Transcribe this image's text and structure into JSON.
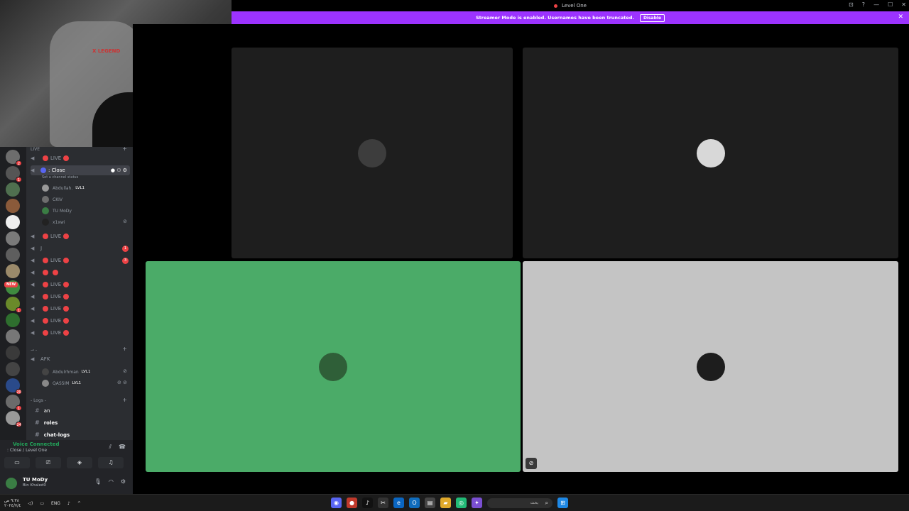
{
  "window": {
    "title": "Level One",
    "controls": {
      "minimize": "—",
      "maximize": "☐",
      "close": "✕"
    }
  },
  "banner": {
    "message": "Streamer Mode is enabled. Usernames have been truncated.",
    "disable_label": "Disable",
    "close_glyph": "✕"
  },
  "webcam": {
    "chair_brand": "X LEGEND"
  },
  "channels": {
    "top_category": "LIVE",
    "list": [
      {
        "label": "LIVE",
        "badges": 2
      },
      {
        "label": ": Close",
        "active": true,
        "status": "Set a channel status"
      },
      {
        "label": "LIVE",
        "badges": 2,
        "count": "1"
      },
      {
        "label": "J",
        "count": ""
      },
      {
        "label": "LIVE",
        "badges": 2,
        "count": "3"
      },
      {
        "label": "",
        "badges": 2
      },
      {
        "label": "LIVE",
        "badges": 2
      },
      {
        "label": "LIVE",
        "badges": 2
      },
      {
        "label": "LIVE",
        "badges": 2
      },
      {
        "label": "LIVE",
        "badges": 2
      },
      {
        "label": "LIVE",
        "badges": 2
      }
    ],
    "close_members": [
      {
        "name": "Abdullah.",
        "lvl": "LVL1"
      },
      {
        "name": "CKIV",
        "lvl": ""
      },
      {
        "name": "TU MoDy",
        "lvl": ""
      },
      {
        "name": "x1xwi",
        "lvl": ""
      }
    ],
    "afk_label": "AFK",
    "afk_members": [
      {
        "name": "Abdulrhman",
        "lvl": "LVL1"
      },
      {
        "name": "QASSIM",
        "lvl": "LVL1"
      }
    ],
    "logs_category": "- Logs -",
    "text_channels": [
      "an",
      "roles",
      "chat-logs"
    ]
  },
  "voice": {
    "status": "Voice Connected",
    "location": ": Close / Level One"
  },
  "user": {
    "name": "TU MoDy",
    "status": "Bin Khaled0"
  },
  "server_badges": [
    "2",
    "1",
    "",
    "",
    "",
    "",
    "",
    "",
    "",
    "1",
    "",
    "",
    "",
    "",
    "20",
    "1",
    "24"
  ],
  "new_badge": "NEW",
  "stage_tiles": [
    {
      "bg": "#1e1e1e",
      "pfp": "#3d3d3d"
    },
    {
      "bg": "#1e1e1e",
      "pfp": "#d8d8d8"
    },
    {
      "bg": "#4bab68",
      "pfp": "#2f5f38"
    },
    {
      "bg": "#c4c4c4",
      "pfp": "#1d1d1d"
    }
  ],
  "taskbar": {
    "time": "٩:٣٨ ص",
    "date": "٢٠٢٤/٧/٤",
    "lang": "ENG",
    "search_placeholder": "بحث"
  },
  "colors": {
    "accent": "#9c33ff",
    "voice_green": "#23a55a",
    "alert_red": "#ed4245"
  }
}
